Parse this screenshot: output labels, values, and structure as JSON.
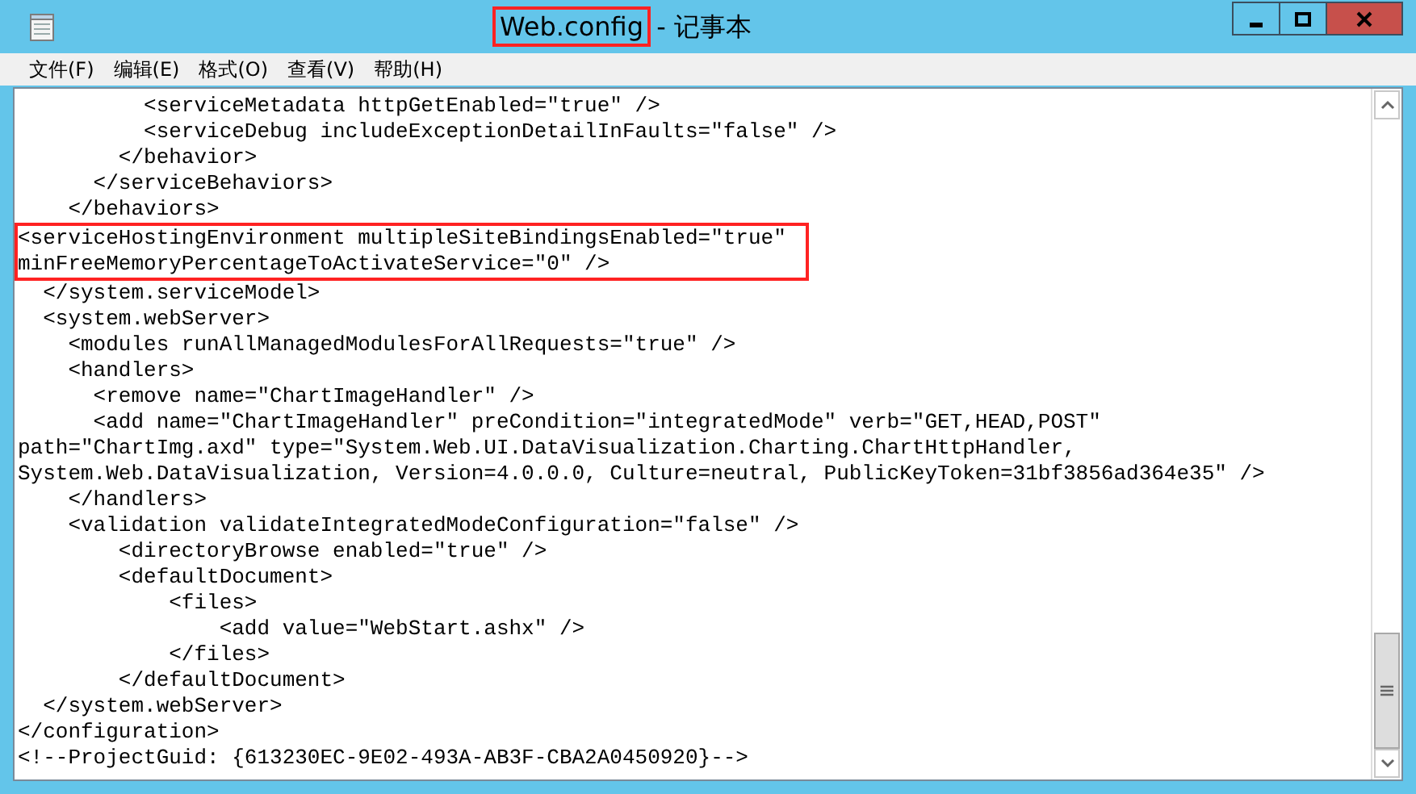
{
  "window": {
    "title": {
      "filename": "Web.config",
      "app": " - 记事本",
      "highlighted": true
    }
  },
  "menu": [
    "文件(F)",
    "编辑(E)",
    "格式(O)",
    "查看(V)",
    "帮助(H)"
  ],
  "lines": [
    {
      "text": "          <serviceMetadata httpGetEnabled=\"true\" />",
      "highlighted": false
    },
    {
      "text": "          <serviceDebug includeExceptionDetailInFaults=\"false\" />",
      "highlighted": false
    },
    {
      "text": "        </behavior>",
      "highlighted": false
    },
    {
      "text": "      </serviceBehaviors>",
      "highlighted": false
    },
    {
      "text": "    </behaviors>",
      "highlighted": false
    },
    {
      "text": "<serviceHostingEnvironment multipleSiteBindingsEnabled=\"true\"",
      "highlighted": true
    },
    {
      "text": "minFreeMemoryPercentageToActivateService=\"0\" />",
      "highlighted": true
    },
    {
      "text": "  </system.serviceModel>",
      "highlighted": false
    },
    {
      "text": "  <system.webServer>",
      "highlighted": false
    },
    {
      "text": "    <modules runAllManagedModulesForAllRequests=\"true\" />",
      "highlighted": false
    },
    {
      "text": "    <handlers>",
      "highlighted": false
    },
    {
      "text": "      <remove name=\"ChartImageHandler\" />",
      "highlighted": false
    },
    {
      "text": "      <add name=\"ChartImageHandler\" preCondition=\"integratedMode\" verb=\"GET,HEAD,POST\"",
      "highlighted": false
    },
    {
      "text": "path=\"ChartImg.axd\" type=\"System.Web.UI.DataVisualization.Charting.ChartHttpHandler,",
      "highlighted": false
    },
    {
      "text": "System.Web.DataVisualization, Version=4.0.0.0, Culture=neutral, PublicKeyToken=31bf3856ad364e35\" />",
      "highlighted": false
    },
    {
      "text": "    </handlers>",
      "highlighted": false
    },
    {
      "text": "    <validation validateIntegratedModeConfiguration=\"false\" />",
      "highlighted": false
    },
    {
      "text": "        <directoryBrowse enabled=\"true\" />",
      "highlighted": false
    },
    {
      "text": "        <defaultDocument>",
      "highlighted": false
    },
    {
      "text": "            <files>",
      "highlighted": false
    },
    {
      "text": "                <add value=\"WebStart.ashx\" />",
      "highlighted": false
    },
    {
      "text": "            </files>",
      "highlighted": false
    },
    {
      "text": "        </defaultDocument>",
      "highlighted": false
    },
    {
      "text": "  </system.webServer>",
      "highlighted": false
    },
    {
      "text": "</configuration>",
      "highlighted": false
    },
    {
      "text": "<!--ProjectGuid: {613230EC-9E02-493A-AB3F-CBA2A0450920}-->",
      "highlighted": false
    }
  ]
}
